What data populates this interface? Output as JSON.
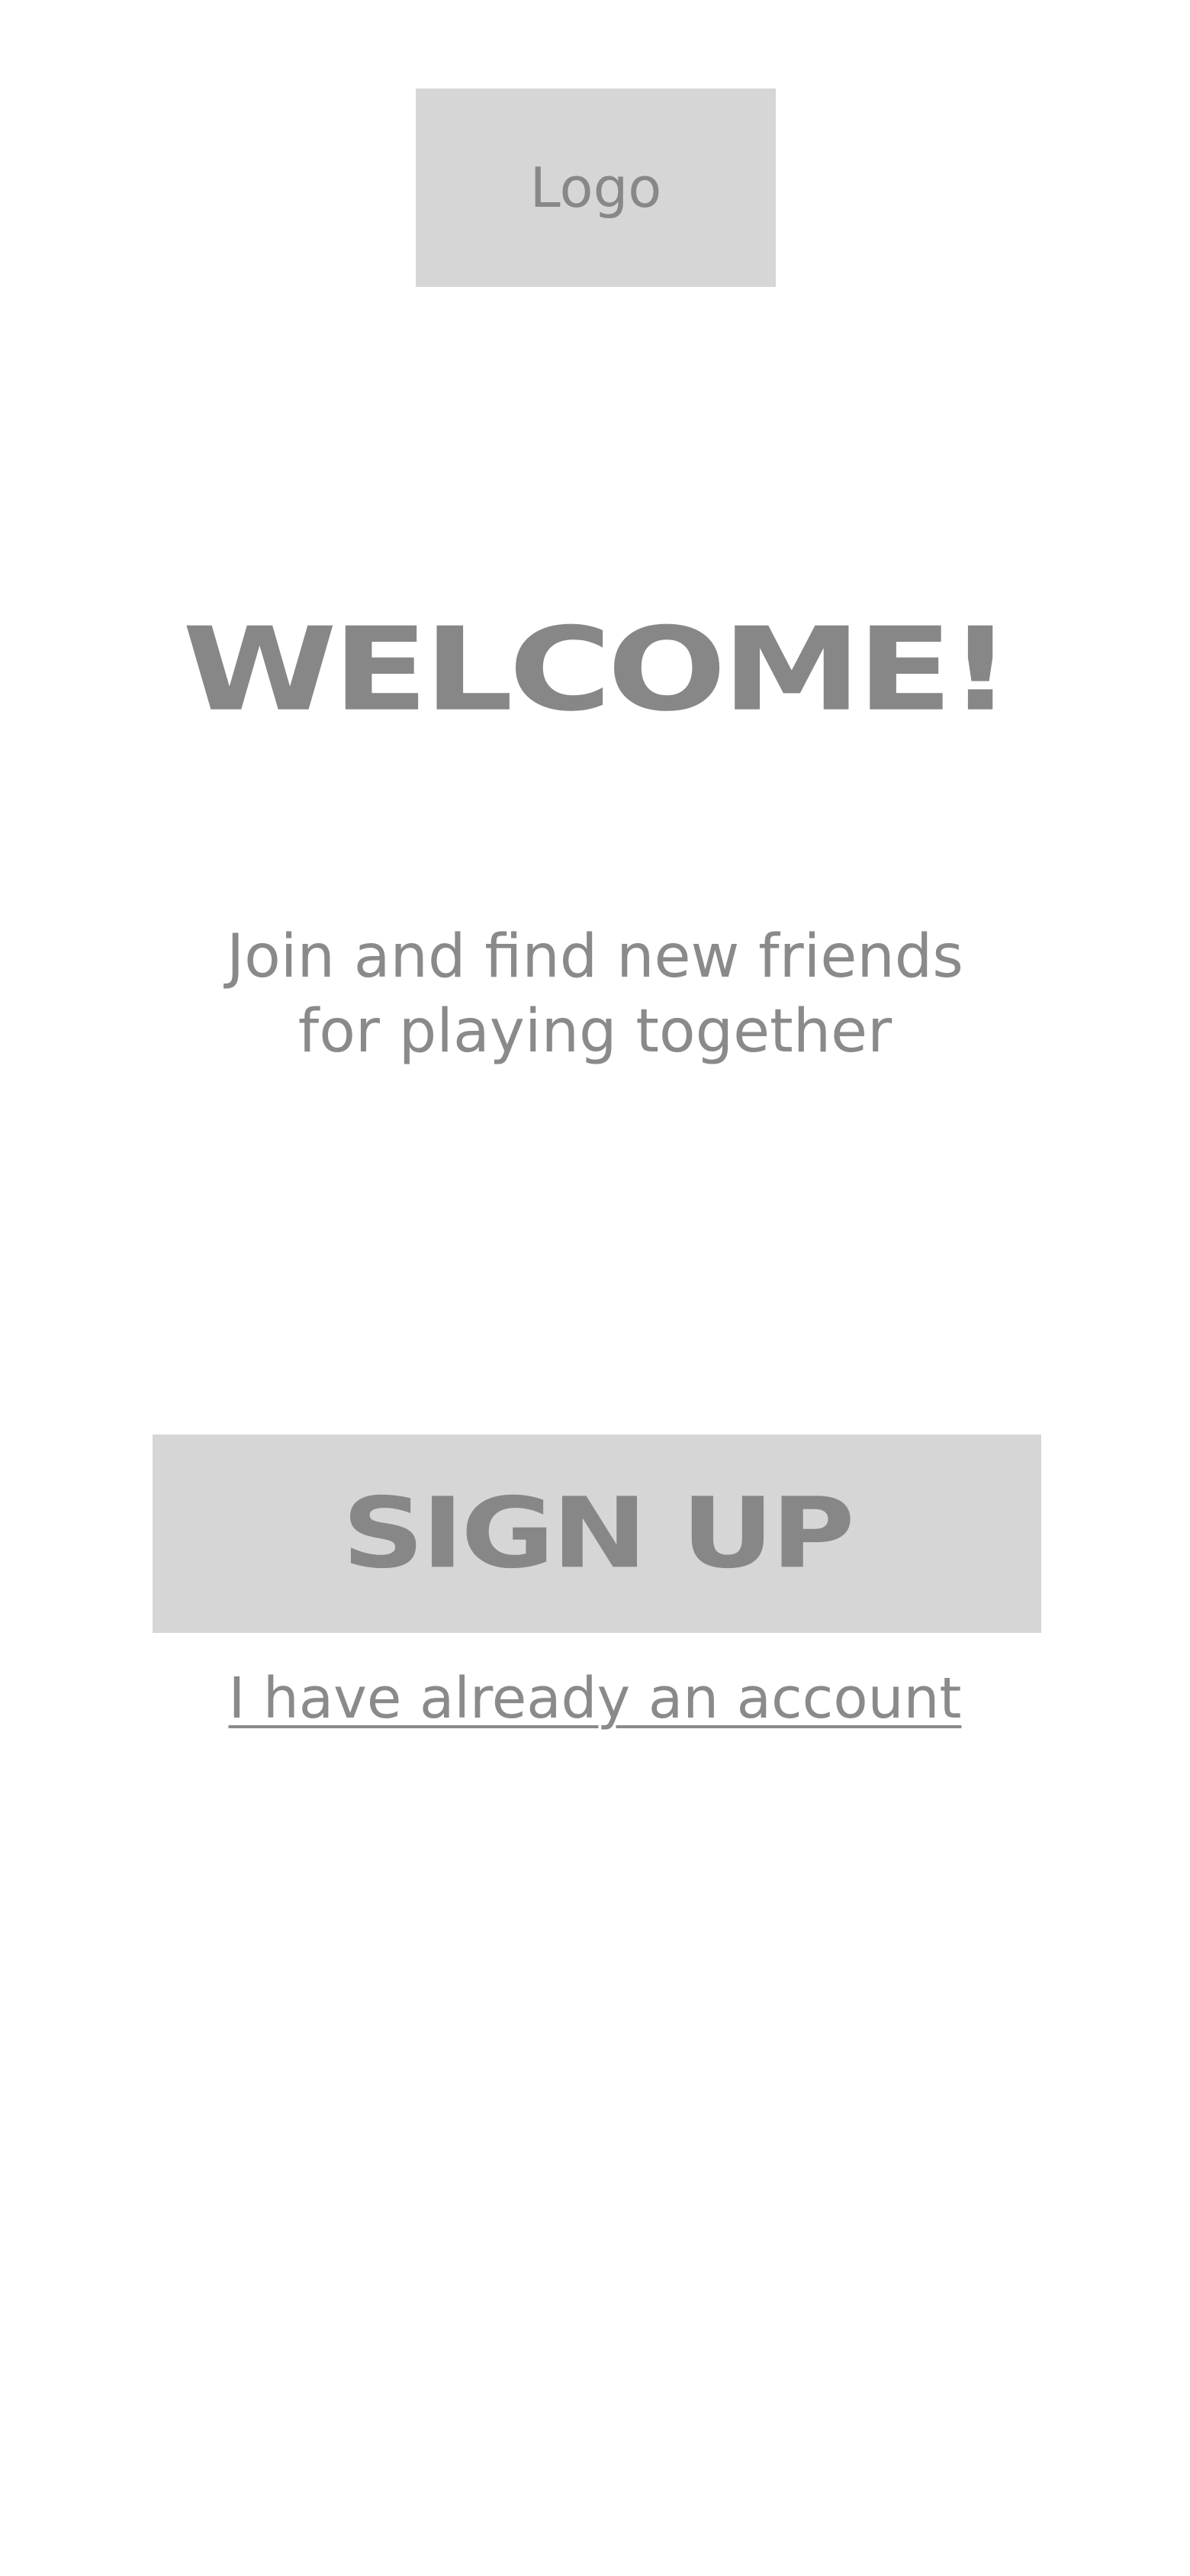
{
  "logo": {
    "label": "Logo"
  },
  "welcome": {
    "title": "WELCOME!"
  },
  "subtitle": {
    "text": "Join and find new friends\nfor playing together"
  },
  "signup": {
    "label": "SIGN UP"
  },
  "login": {
    "link_text": "I have already an account"
  },
  "colors": {
    "background": "#ffffff",
    "placeholder_fill": "#d6d6d6",
    "text_gray": "#878787"
  }
}
